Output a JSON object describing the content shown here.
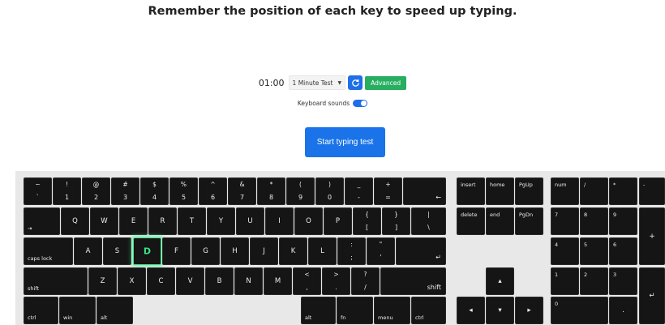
{
  "headline": "Remember the position of each key to speed up typing.",
  "controls": {
    "timer": "01:00",
    "test_select": "1 Minute Test",
    "advanced_label": "Advanced",
    "sounds_label": "Keyboard sounds",
    "sounds_on": true
  },
  "start_label": "Start typing test",
  "colors": {
    "accent": "#1a73e8",
    "advanced": "#27ae60",
    "highlight": "#3be38a",
    "key": "#151515"
  },
  "highlight_key": "D",
  "keys": {
    "tilde": {
      "top": "~",
      "bot": "`"
    },
    "d1": {
      "top": "!",
      "bot": "1"
    },
    "d2": {
      "top": "@",
      "bot": "2"
    },
    "d3": {
      "top": "#",
      "bot": "3"
    },
    "d4": {
      "top": "$",
      "bot": "4"
    },
    "d5": {
      "top": "%",
      "bot": "5"
    },
    "d6": {
      "top": "^",
      "bot": "6"
    },
    "d7": {
      "top": "&",
      "bot": "7"
    },
    "d8": {
      "top": "*",
      "bot": "8"
    },
    "d9": {
      "top": "(",
      "bot": "9"
    },
    "d0": {
      "top": ")",
      "bot": "0"
    },
    "minus": {
      "top": "_",
      "bot": "-"
    },
    "equals": {
      "top": "+",
      "bot": "="
    },
    "backspace": "←",
    "tab": "⇥",
    "q": "Q",
    "w": "W",
    "e": "E",
    "r": "R",
    "t": "T",
    "y": "Y",
    "u": "U",
    "i": "I",
    "o": "O",
    "p": "P",
    "lbracket": {
      "top": "{",
      "bot": "["
    },
    "rbracket": {
      "top": "}",
      "bot": "]"
    },
    "backslash": {
      "top": "|",
      "bot": "\\"
    },
    "caps": "caps lock",
    "a": "A",
    "s": "S",
    "d": "D",
    "f": "F",
    "g": "G",
    "h": "H",
    "j": "J",
    "k": "K",
    "l": "L",
    "semicolon": {
      "top": ":",
      "bot": ";"
    },
    "quote": {
      "top": "\"",
      "bot": "'"
    },
    "enter": "↵",
    "lshift": "shift",
    "z": "Z",
    "x": "X",
    "c": "C",
    "v": "V",
    "b": "B",
    "n": "N",
    "m": "M",
    "comma": {
      "top": "<",
      "bot": ","
    },
    "period": {
      "top": ">",
      "bot": "."
    },
    "slash": {
      "top": "?",
      "bot": "/"
    },
    "rshift": "shift",
    "lctrl": "ctrl",
    "win": "win",
    "lalt": "alt",
    "ralt": "alt",
    "fn": "fn",
    "menu": "menu",
    "rctrl": "ctrl",
    "insert": "insert",
    "home": "home",
    "pgup": "PgUp",
    "delete": "delete",
    "end": "end",
    "pgdn": "PgDn",
    "up": "▴",
    "left": "◂",
    "down": "▾",
    "right": "▸",
    "num": "num",
    "ndiv": "/",
    "nmul": "*",
    "nminus": "-",
    "n7": "7",
    "n8": "8",
    "n9": "9",
    "nplus": "+",
    "n4": "4",
    "n5": "5",
    "n6": "6",
    "n1": "1",
    "n2": "2",
    "n3": "3",
    "nenter": "↵",
    "n0": "0",
    "ndot": "."
  }
}
